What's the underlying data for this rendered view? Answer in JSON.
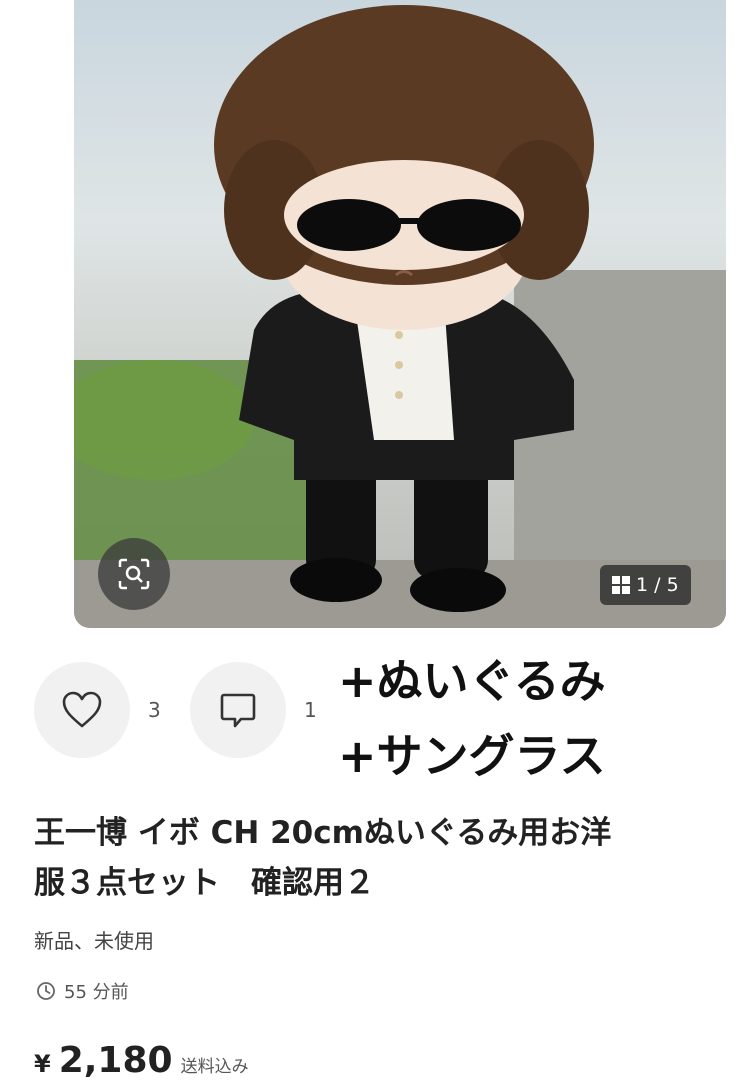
{
  "gallery": {
    "counter": "1 / 5"
  },
  "actions": {
    "likes": "3",
    "comments": "1"
  },
  "overlay": {
    "line1": "+ぬいぐるみ",
    "line2": "+サングラス"
  },
  "item": {
    "title_line1": "王一博 イボ CH 20cmぬいぐるみ用お洋",
    "title_line2": "服３点セット　確認用２",
    "condition": "新品、未使用",
    "time": "55 分前",
    "currency": "¥",
    "price": "2,180",
    "shipping": "送料込み"
  },
  "icons": [
    "zoom-scan-icon",
    "grid-icon",
    "heart-icon",
    "comment-icon",
    "clock-icon"
  ]
}
